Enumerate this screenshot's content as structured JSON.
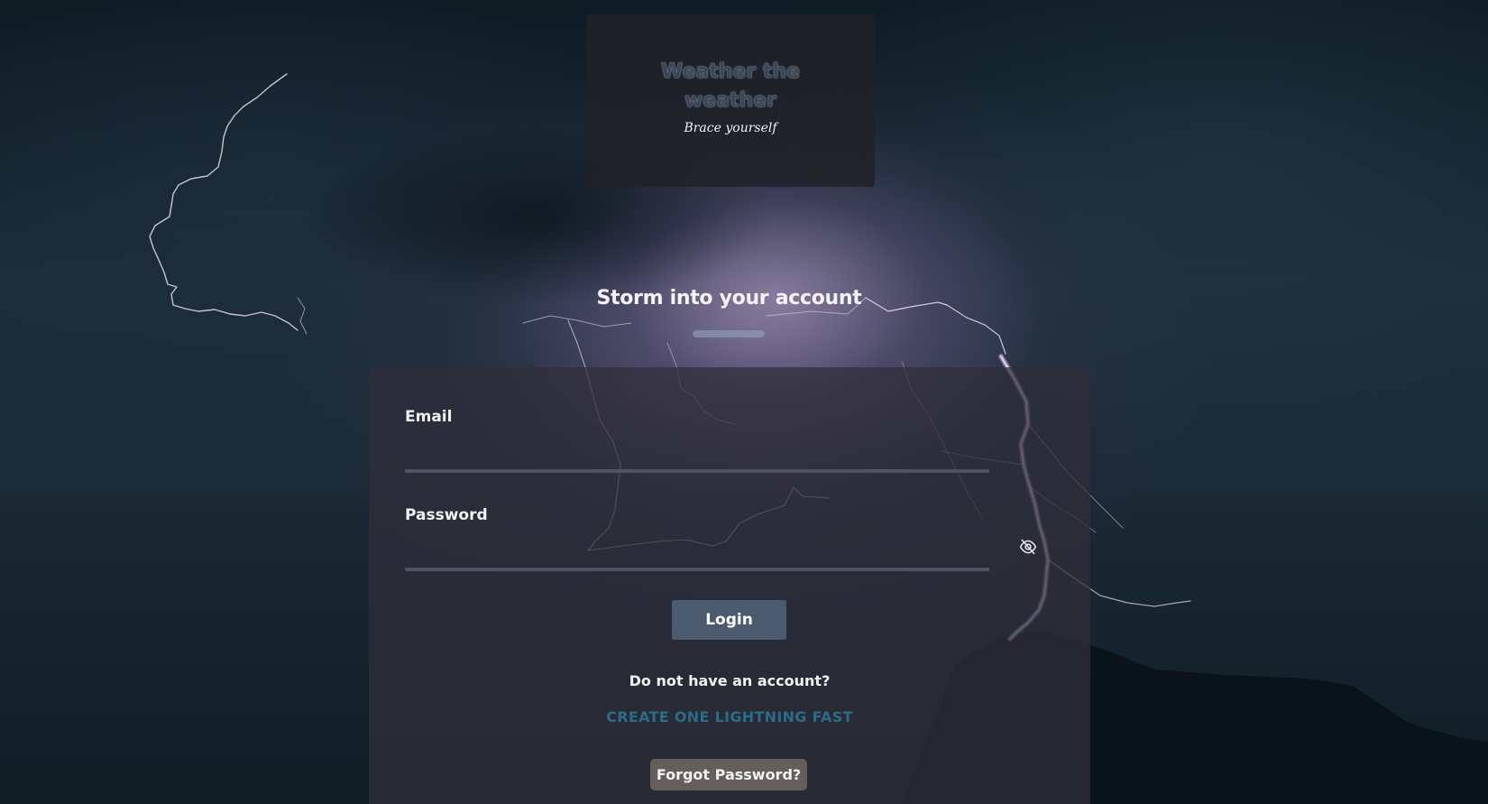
{
  "brand": {
    "title": "Weather the weather",
    "tagline": "Brace yourself"
  },
  "page": {
    "heading": "Storm into your account"
  },
  "form": {
    "email_label": "Email",
    "email_value": "",
    "password_label": "Password",
    "password_value": "",
    "login_label": "Login",
    "no_account_text": "Do not have an account?",
    "create_link": "CREATE ONE LIGHTNING FAST",
    "forgot_label": "Forgot Password?"
  },
  "icons": {
    "password_toggle": "eye-slash-icon"
  },
  "colors": {
    "accent_link": "#2b6d86",
    "button": "#4b5a6f",
    "forgot_button": "#655e5a",
    "input_underline": "#4a5464"
  }
}
